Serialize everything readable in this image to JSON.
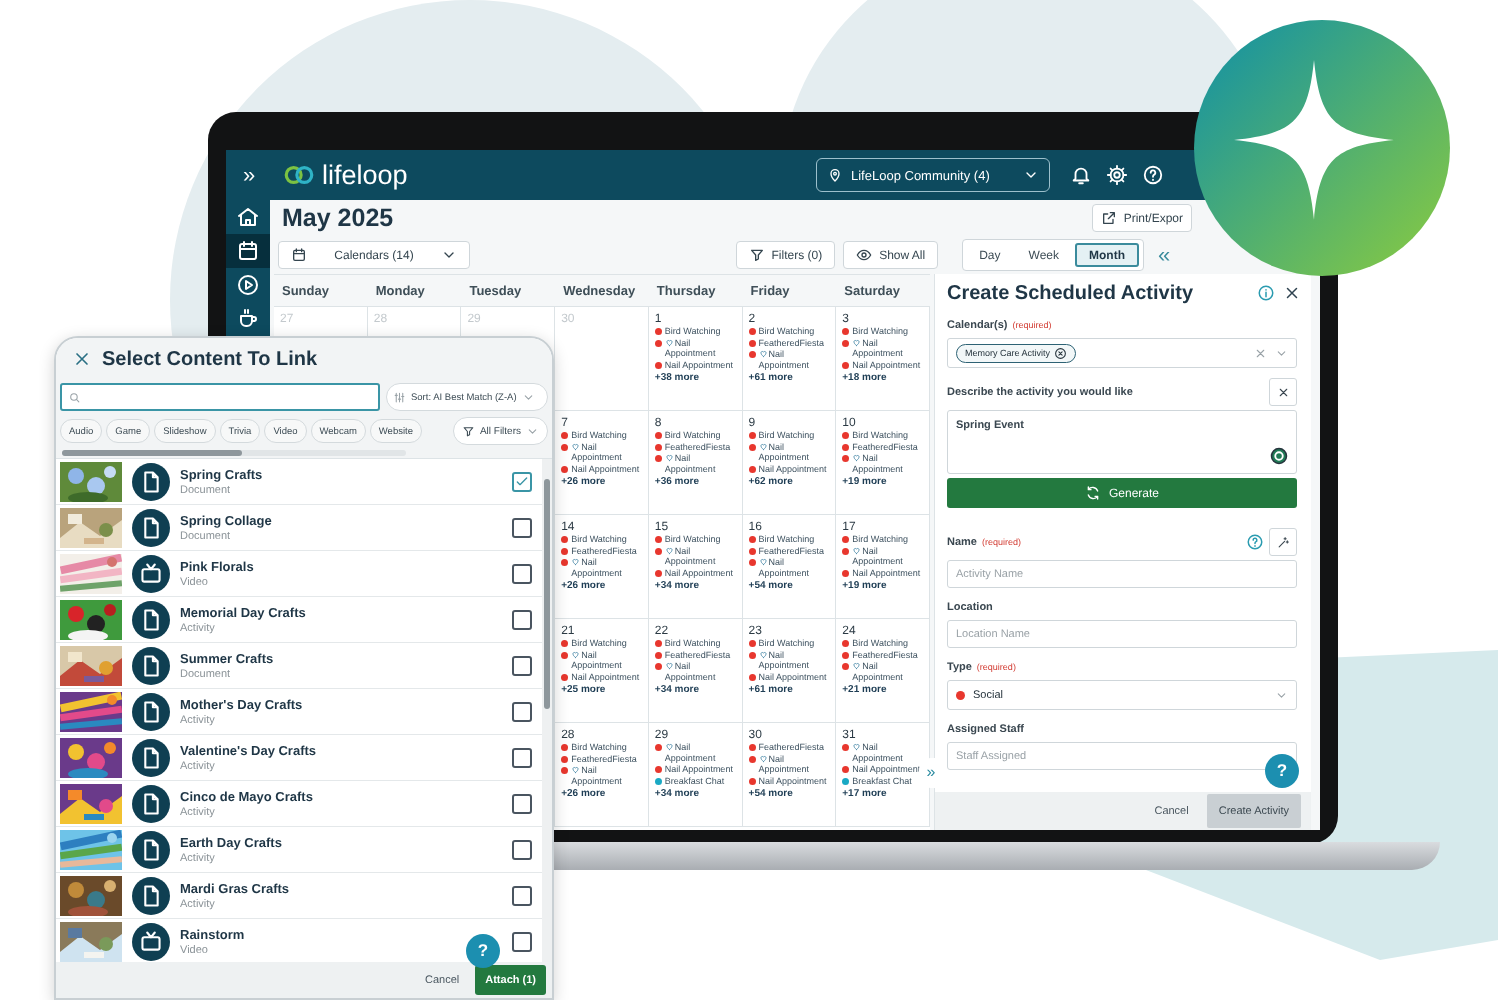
{
  "app": {
    "expand": "»",
    "logo_text": "lifeloop",
    "community": "LifeLoop Community (4)"
  },
  "nav": [
    {
      "selected": false
    },
    {
      "selected": true
    },
    {
      "selected": false
    },
    {
      "selected": false
    }
  ],
  "header": {
    "title": "May 2025",
    "print": "Print/Expor"
  },
  "toolbar": {
    "calendars": "Calendars (14)",
    "filters": "Filters (0)",
    "show_all": "Show All",
    "views": [
      {
        "label": "Day",
        "selected": false
      },
      {
        "label": "Week",
        "selected": false
      },
      {
        "label": "Month",
        "selected": true
      }
    ],
    "collapse": "«"
  },
  "calendar": {
    "weekdays": [
      "Sunday",
      "Monday",
      "Tuesday",
      "Wednesday",
      "Thursday",
      "Friday",
      "Saturday"
    ],
    "weeks": [
      {
        "days": [
          {
            "date": "27",
            "other_month": true
          },
          {
            "date": "28",
            "other_month": true
          },
          {
            "date": "29",
            "other_month": true
          },
          {
            "date": "30",
            "other_month": true
          },
          {
            "date": "1",
            "other_month": false,
            "events": [
              {
                "title": "Bird Watching",
                "color": "#e8372e",
                "heart": false
              },
              {
                "title": "Nail Appointment",
                "color": "#e8372e",
                "heart": true
              },
              {
                "title": "Nail Appointment",
                "color": "#e8372e",
                "heart": false
              }
            ],
            "more": "+38 more"
          },
          {
            "date": "2",
            "other_month": false,
            "events": [
              {
                "title": "Bird Watching",
                "color": "#e8372e",
                "heart": false
              },
              {
                "title": "FeatheredFiesta",
                "color": "#e8372e",
                "heart": false
              },
              {
                "title": "Nail Appointment",
                "color": "#e8372e",
                "heart": true
              }
            ],
            "more": "+61 more"
          },
          {
            "date": "3",
            "other_month": false,
            "events": [
              {
                "title": "Bird Watching",
                "color": "#e8372e",
                "heart": false
              },
              {
                "title": "Nail Appointment",
                "color": "#e8372e",
                "heart": true
              },
              {
                "title": "Nail Appointment",
                "color": "#e8372e",
                "heart": false
              }
            ],
            "more": "+18 more"
          }
        ]
      },
      {
        "days": [
          {
            "date": "7",
            "other_month": false,
            "events": [
              {
                "title": "Bird Watching",
                "color": "#e8372e",
                "heart": false
              },
              {
                "title": "Nail Appointment",
                "color": "#e8372e",
                "heart": true
              },
              {
                "title": "Nail Appointment",
                "color": "#e8372e",
                "heart": false
              }
            ],
            "more": "+26 more"
          },
          {
            "date": "8",
            "other_month": false,
            "events": [
              {
                "title": "Bird Watching",
                "color": "#e8372e",
                "heart": false
              },
              {
                "title": "FeatheredFiesta",
                "color": "#e8372e",
                "heart": false
              },
              {
                "title": "Nail Appointment",
                "color": "#e8372e",
                "heart": true
              }
            ],
            "more": "+36 more"
          },
          {
            "date": "9",
            "other_month": false,
            "events": [
              {
                "title": "Bird Watching",
                "color": "#e8372e",
                "heart": false
              },
              {
                "title": "Nail Appointment",
                "color": "#e8372e",
                "heart": true
              },
              {
                "title": "Nail Appointment",
                "color": "#e8372e",
                "heart": false
              }
            ],
            "more": "+62 more"
          },
          {
            "date": "10",
            "other_month": false,
            "events": [
              {
                "title": "Bird Watching",
                "color": "#e8372e",
                "heart": false
              },
              {
                "title": "FeatheredFiesta",
                "color": "#e8372e",
                "heart": false
              },
              {
                "title": "Nail Appointment",
                "color": "#e8372e",
                "heart": true
              }
            ],
            "more": "+19 more"
          }
        ]
      },
      {
        "days": [
          {
            "date": "14",
            "other_month": false,
            "events": [
              {
                "title": "Bird Watching",
                "color": "#e8372e",
                "heart": false
              },
              {
                "title": "FeatheredFiesta",
                "color": "#e8372e",
                "heart": false
              },
              {
                "title": "Nail Appointment",
                "color": "#e8372e",
                "heart": true
              }
            ],
            "more": "+26 more"
          },
          {
            "date": "15",
            "other_month": false,
            "events": [
              {
                "title": "Bird Watching",
                "color": "#e8372e",
                "heart": false
              },
              {
                "title": "Nail Appointment",
                "color": "#e8372e",
                "heart": true
              },
              {
                "title": "Nail Appointment",
                "color": "#e8372e",
                "heart": false
              }
            ],
            "more": "+34 more"
          },
          {
            "date": "16",
            "other_month": false,
            "events": [
              {
                "title": "Bird Watching",
                "color": "#e8372e",
                "heart": false
              },
              {
                "title": "FeatheredFiesta",
                "color": "#e8372e",
                "heart": false
              },
              {
                "title": "Nail Appointment",
                "color": "#e8372e",
                "heart": true
              }
            ],
            "more": "+54 more"
          },
          {
            "date": "17",
            "other_month": false,
            "events": [
              {
                "title": "Bird Watching",
                "color": "#e8372e",
                "heart": false
              },
              {
                "title": "Nail Appointment",
                "color": "#e8372e",
                "heart": true
              },
              {
                "title": "Nail Appointment",
                "color": "#e8372e",
                "heart": false
              }
            ],
            "more": "+19 more"
          }
        ]
      },
      {
        "days": [
          {
            "date": "21",
            "other_month": false,
            "events": [
              {
                "title": "Bird Watching",
                "color": "#e8372e",
                "heart": false
              },
              {
                "title": "Nail Appointment",
                "color": "#e8372e",
                "heart": true
              },
              {
                "title": "Nail Appointment",
                "color": "#e8372e",
                "heart": false
              }
            ],
            "more": "+25 more"
          },
          {
            "date": "22",
            "other_month": false,
            "events": [
              {
                "title": "Bird Watching",
                "color": "#e8372e",
                "heart": false
              },
              {
                "title": "FeatheredFiesta",
                "color": "#e8372e",
                "heart": false
              },
              {
                "title": "Nail Appointment",
                "color": "#e8372e",
                "heart": true
              }
            ],
            "more": "+34 more"
          },
          {
            "date": "23",
            "other_month": false,
            "events": [
              {
                "title": "Bird Watching",
                "color": "#e8372e",
                "heart": false
              },
              {
                "title": "Nail Appointment",
                "color": "#e8372e",
                "heart": true
              },
              {
                "title": "Nail Appointment",
                "color": "#e8372e",
                "heart": false
              }
            ],
            "more": "+61 more"
          },
          {
            "date": "24",
            "other_month": false,
            "events": [
              {
                "title": "Bird Watching",
                "color": "#e8372e",
                "heart": false
              },
              {
                "title": "FeatheredFiesta",
                "color": "#e8372e",
                "heart": false
              },
              {
                "title": "Nail Appointment",
                "color": "#e8372e",
                "heart": true
              }
            ],
            "more": "+21 more"
          }
        ]
      },
      {
        "days": [
          {
            "date": "28",
            "other_month": false,
            "events": [
              {
                "title": "Bird Watching",
                "color": "#e8372e",
                "heart": false
              },
              {
                "title": "FeatheredFiesta",
                "color": "#e8372e",
                "heart": false
              },
              {
                "title": "Nail Appointment",
                "color": "#e8372e",
                "heart": true
              }
            ],
            "more": "+26 more"
          },
          {
            "date": "29",
            "other_month": false,
            "events": [
              {
                "title": "Nail Appointment",
                "color": "#e8372e",
                "heart": true
              },
              {
                "title": "Nail Appointment",
                "color": "#e8372e",
                "heart": false
              },
              {
                "title": "Breakfast Chat",
                "color": "#1aa9c4",
                "heart": false
              }
            ],
            "more": "+34 more"
          },
          {
            "date": "30",
            "other_month": false,
            "events": [
              {
                "title": "FeatheredFiesta",
                "color": "#e8372e",
                "heart": false
              },
              {
                "title": "Nail Appointment",
                "color": "#e8372e",
                "heart": true
              },
              {
                "title": "Nail Appointment",
                "color": "#e8372e",
                "heart": false
              }
            ],
            "more": "+54 more"
          },
          {
            "date": "31",
            "other_month": false,
            "events": [
              {
                "title": "Nail Appointment",
                "color": "#e8372e",
                "heart": true
              },
              {
                "title": "Nail Appointment",
                "color": "#e8372e",
                "heart": false
              },
              {
                "title": "Breakfast Chat",
                "color": "#1aa9c4",
                "heart": false
              }
            ],
            "more": "+17 more"
          }
        ]
      }
    ]
  },
  "activity_panel": {
    "title": "Create Scheduled Activity",
    "expand_handle": "»",
    "fields": [
      {
        "kind": "chips",
        "label": "Calendar(s)",
        "required": "(required)",
        "chips": [
          "Memory Care Activity"
        ]
      },
      {
        "kind": "prompt",
        "label": "Describe the activity you would like",
        "value": "Spring Event",
        "action": "Generate"
      },
      {
        "kind": "ai_text",
        "label": "Name",
        "required": "(required)",
        "placeholder": "Activity Name"
      },
      {
        "kind": "text",
        "label": "Location",
        "placeholder": "Location Name"
      },
      {
        "kind": "select",
        "label": "Type",
        "required": "(required)",
        "value": "Social",
        "color": "#e8372e"
      },
      {
        "kind": "text",
        "label": "Assigned Staff",
        "placeholder": "Staff Assigned"
      }
    ],
    "help": "?",
    "cancel": "Cancel",
    "submit": "Create Activity"
  },
  "content_picker": {
    "title": "Select Content To Link",
    "sort": "Sort: AI Best Match (Z-A)",
    "chips": [
      "Audio",
      "Game",
      "Slideshow",
      "Trivia",
      "Video",
      "Webcam",
      "Website"
    ],
    "all_filters": "All Filters",
    "items": [
      {
        "title": "Spring Crafts",
        "type": "Document",
        "kind": "document",
        "checked": true
      },
      {
        "title": "Spring Collage",
        "type": "Document",
        "kind": "document",
        "checked": false
      },
      {
        "title": "Pink Florals",
        "type": "Video",
        "kind": "video",
        "checked": false
      },
      {
        "title": "Memorial Day Crafts",
        "type": "Activity",
        "kind": "document",
        "checked": false
      },
      {
        "title": "Summer Crafts",
        "type": "Document",
        "kind": "document",
        "checked": false
      },
      {
        "title": "Mother's Day Crafts",
        "type": "Activity",
        "kind": "document",
        "checked": false
      },
      {
        "title": "Valentine's Day Crafts",
        "type": "Activity",
        "kind": "document",
        "checked": false
      },
      {
        "title": "Cinco de Mayo Crafts",
        "type": "Activity",
        "kind": "document",
        "checked": false
      },
      {
        "title": "Earth Day Crafts",
        "type": "Activity",
        "kind": "document",
        "checked": false
      },
      {
        "title": "Mardi Gras Crafts",
        "type": "Activity",
        "kind": "document",
        "checked": false
      },
      {
        "title": "Rainstorm",
        "type": "Video",
        "kind": "video",
        "checked": false
      }
    ],
    "help": "?",
    "cancel": "Cancel",
    "attach": "Attach (1)"
  }
}
